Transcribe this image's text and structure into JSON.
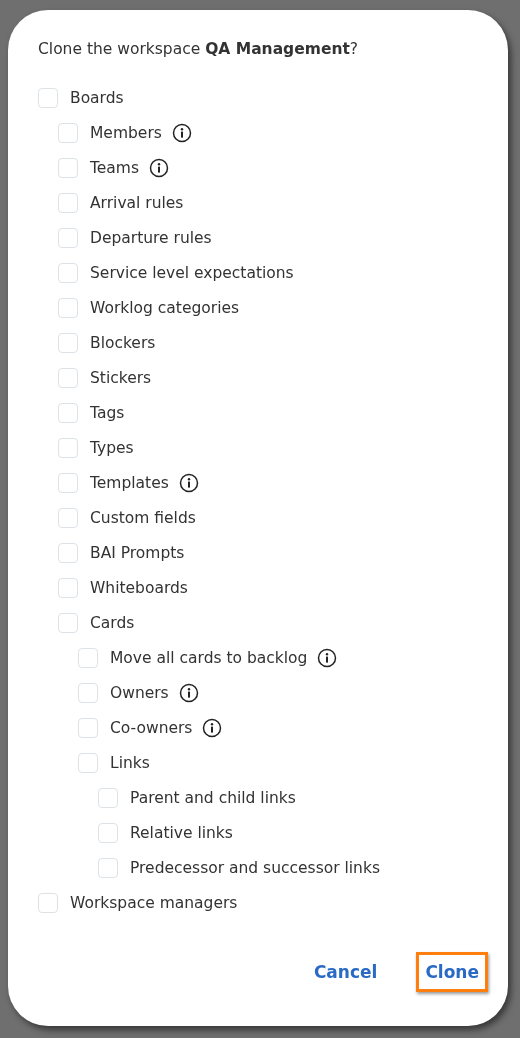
{
  "dialog": {
    "question": "Clone the workspace **QA Management**?",
    "options": [
      {
        "label": "Boards",
        "checked": false,
        "info": false,
        "children": [
          {
            "label": "Members",
            "checked": false,
            "info": true
          },
          {
            "label": "Teams",
            "checked": false,
            "info": true
          },
          {
            "label": "Arrival rules",
            "checked": false,
            "info": false
          },
          {
            "label": "Departure rules",
            "checked": false,
            "info": false
          },
          {
            "label": "Service level expectations",
            "checked": false,
            "info": false
          },
          {
            "label": "Worklog categories",
            "checked": false,
            "info": false
          },
          {
            "label": "Blockers",
            "checked": false,
            "info": false
          },
          {
            "label": "Stickers",
            "checked": false,
            "info": false
          },
          {
            "label": "Tags",
            "checked": false,
            "info": false
          },
          {
            "label": "Types",
            "checked": false,
            "info": false
          },
          {
            "label": "Templates",
            "checked": false,
            "info": true
          },
          {
            "label": "Custom fields",
            "checked": false,
            "info": false
          },
          {
            "label": "BAI Prompts",
            "checked": false,
            "info": false
          },
          {
            "label": "Whiteboards",
            "checked": false,
            "info": false
          },
          {
            "label": "Cards",
            "checked": false,
            "info": false,
            "children": [
              {
                "label": "Move all cards to backlog",
                "checked": false,
                "info": true
              },
              {
                "label": "Owners",
                "checked": false,
                "info": true
              },
              {
                "label": "Co-owners",
                "checked": false,
                "info": true
              },
              {
                "label": "Links",
                "checked": false,
                "info": false,
                "children": [
                  {
                    "label": "Parent and child links",
                    "checked": false,
                    "info": false
                  },
                  {
                    "label": "Relative links",
                    "checked": false,
                    "info": false
                  },
                  {
                    "label": "Predecessor and successor links",
                    "checked": false,
                    "info": false
                  }
                ]
              }
            ]
          }
        ]
      },
      {
        "label": "Workspace managers",
        "checked": false,
        "info": false
      }
    ],
    "buttons": [
      {
        "label": "Cancel",
        "highlighted": false
      },
      {
        "label": "Clone",
        "highlighted": true
      }
    ]
  }
}
